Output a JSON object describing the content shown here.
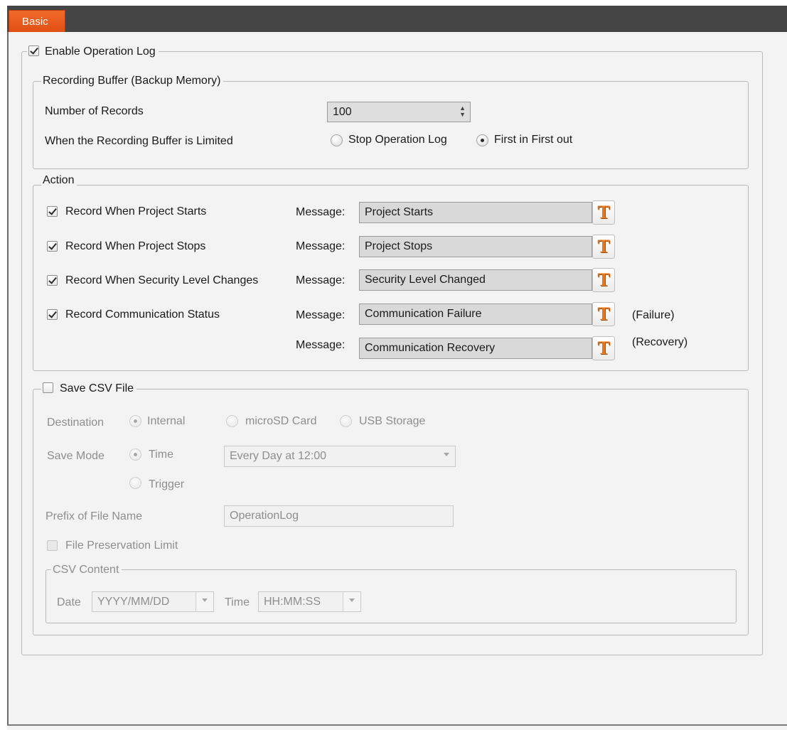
{
  "tab": {
    "label": "Basic"
  },
  "enable_log": {
    "label": "Enable Operation Log",
    "checked": true
  },
  "recording_buffer": {
    "legend": "Recording Buffer (Backup Memory)",
    "num_records_label": "Number of Records",
    "num_records_value": "100",
    "limit_label": "When the Recording Buffer is Limited",
    "options": [
      {
        "label": "Stop Operation Log",
        "selected": false
      },
      {
        "label": "First in First out",
        "selected": true
      }
    ]
  },
  "action": {
    "legend": "Action",
    "message_label": "Message:",
    "rows": [
      {
        "label": "Record When Project Starts",
        "checked": true,
        "message": "Project Starts",
        "suffix": ""
      },
      {
        "label": "Record When Project Stops",
        "checked": true,
        "message": "Project Stops",
        "suffix": ""
      },
      {
        "label": "Record When Security Level Changes",
        "checked": true,
        "message": "Security Level Changed",
        "suffix": ""
      },
      {
        "label": "Record Communication Status",
        "checked": true,
        "message": "Communication Failure",
        "suffix": "(Failure)"
      },
      {
        "label": "",
        "checked": null,
        "message": "Communication Recovery",
        "suffix": "(Recovery)"
      }
    ],
    "text_button_glyph": "T"
  },
  "csv": {
    "legend": "Save CSV File",
    "checked": false,
    "destination_label": "Destination",
    "destinations": [
      {
        "label": "Internal",
        "selected": true
      },
      {
        "label": "microSD Card",
        "selected": false
      },
      {
        "label": "USB Storage",
        "selected": false
      }
    ],
    "save_mode_label": "Save Mode",
    "save_modes": [
      {
        "label": "Time",
        "selected": true
      },
      {
        "label": "Trigger",
        "selected": false
      }
    ],
    "schedule_value": "Every Day at 12:00",
    "prefix_label": "Prefix of File Name",
    "prefix_value": "OperationLog",
    "preservation_label": "File Preservation Limit",
    "content": {
      "legend": "CSV Content",
      "date_label": "Date",
      "date_value": "YYYY/MM/DD",
      "time_label": "Time",
      "time_value": "HH:MM:SS"
    }
  }
}
